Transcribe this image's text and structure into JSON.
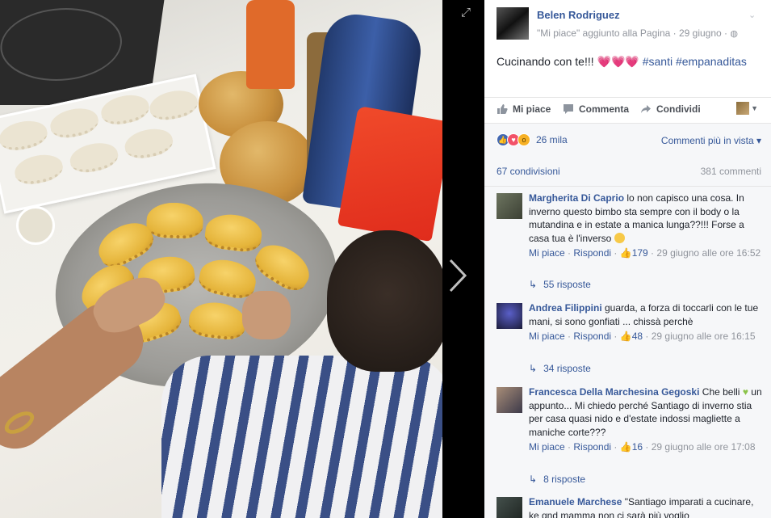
{
  "post": {
    "author": "Belen Rodriguez",
    "subline": "\"Mi piace\" aggiunto alla Pagina · 29 giugno ·",
    "text_main": "Cucinando con te!!! ",
    "hearts": "💗💗💗",
    "tag1": "#santi",
    "tag2": "#empanaditas"
  },
  "actions": {
    "like": "Mi piace",
    "comment": "Commenta",
    "share": "Condividi"
  },
  "stats": {
    "reactions": "26 mila",
    "comment_filter": "Commenti più in vista ▾",
    "shares": "67 condivisioni",
    "comments": "381 commenti"
  },
  "comments": [
    {
      "name": "Margherita Di Caprio",
      "text": " lo non capisco una cosa. In inverno questo bimbo sta sempre con il body o la mutandina e in estate a manica lunga??!!! Forse a casa tua è l'inverso ",
      "like": "Mi piace",
      "reply": "Rispondi",
      "likes": "179",
      "time": "29 giugno alle ore 16:52",
      "replies": "55 risposte"
    },
    {
      "name": "Andrea Filippini",
      "text": " guarda, a forza di toccarli con le tue mani, si sono gonfiati ... chissà perchè",
      "like": "Mi piace",
      "reply": "Rispondi",
      "likes": "48",
      "time": "29 giugno alle ore 16:15",
      "replies": "34 risposte"
    },
    {
      "name": "Francesca Della Marchesina Gegoski",
      "text_a": " Che belli ",
      "text_b": " un appunto... Mi chiedo perché Santiago di inverno stia per casa quasi nido e d'estate indossi magliette a maniche corte???",
      "like": "Mi piace",
      "reply": "Rispondi",
      "likes": "16",
      "time": "29 giugno alle ore 17:08",
      "replies": "8 risposte"
    },
    {
      "name": "Emanuele Marchese",
      "text": " \"Santiago imparati a cucinare, ke qnd mamma non ci sarà più voglio"
    }
  ],
  "icons": {
    "expand": "expand-icon",
    "next": "chevron-right-icon",
    "globe": "globe-icon",
    "like": "thumbs-up-icon",
    "comment": "comment-bubble-icon",
    "share": "share-arrow-icon",
    "reply": "reply-arrow-icon"
  }
}
